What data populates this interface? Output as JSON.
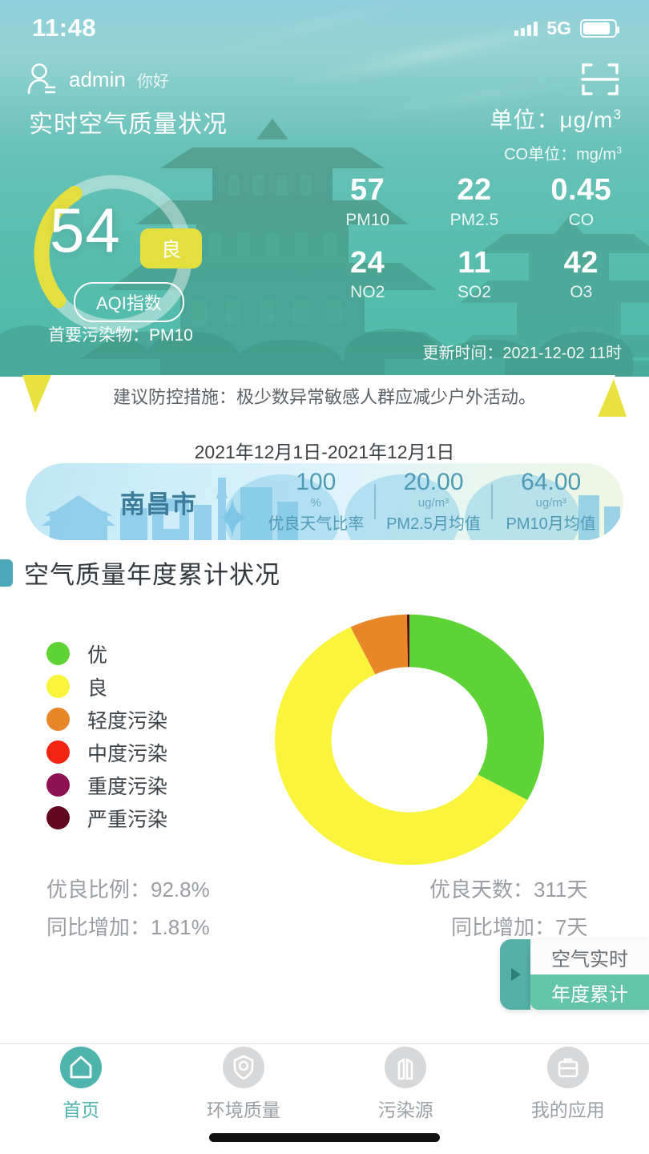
{
  "status_bar": {
    "time": "11:48",
    "network": "5G",
    "signal_icon": "signal-bars-icon",
    "battery_icon": "battery-icon"
  },
  "header": {
    "user_icon": "user-avatar-icon",
    "user_name": "admin",
    "greeting": "你好",
    "scan_icon": "scan-qr-icon",
    "title": "实时空气质量状况",
    "unit_label": "单位：",
    "unit_value": "μg/m",
    "unit_sup": "3",
    "co_unit_label": "CO单位：",
    "co_unit_value": "mg/m",
    "co_unit_sup": "3"
  },
  "aqi": {
    "value": "54",
    "level": "良",
    "chip": "AQI指数",
    "primary_label": "首要污染物：",
    "primary_value": "PM10",
    "updated_label": "更新时间：",
    "updated_value": "2021-12-02 11时",
    "gauge_color": "#e3df3f",
    "gauge_track_color": "rgba(255,255,255,0.45)",
    "gauge_percent": 27
  },
  "pollutants": [
    {
      "value": "57",
      "key": "PM10"
    },
    {
      "value": "22",
      "key": "PM2.5"
    },
    {
      "value": "0.45",
      "key": "CO"
    },
    {
      "value": "24",
      "key": "NO2"
    },
    {
      "value": "11",
      "key": "SO2"
    },
    {
      "value": "42",
      "key": "O3"
    }
  ],
  "advice": {
    "text": "建议防控措施：极少数异常敏感人群应减少户外活动。",
    "accent_color": "#e8e241"
  },
  "city_card": {
    "date_range": "2021年12月1日-2021年12月1日",
    "city": "南昌市",
    "stats": [
      {
        "value": "100",
        "unit": "%",
        "label": "优良天气比率"
      },
      {
        "value": "20.00",
        "unit": "ug/m³",
        "label": "PM2.5月均值"
      },
      {
        "value": "64.00",
        "unit": "ug/m³",
        "label": "PM10月均值"
      }
    ]
  },
  "section": {
    "title": "空气质量年度累计状况",
    "accent_color": "#4ca8b8"
  },
  "chart_data": {
    "type": "pie",
    "title": "空气质量年度累计状况",
    "legend_position": "left",
    "categories": [
      "优",
      "良",
      "轻度污染",
      "中度污染",
      "重度污染",
      "严重污染"
    ],
    "colors": [
      "#5ed336",
      "#fbf43c",
      "#e8862a",
      "#f42412",
      "#8e1055",
      "#61081e"
    ],
    "values": [
      33.0,
      59.8,
      6.9,
      0.0,
      0.0,
      0.3
    ],
    "unit": "%",
    "inner_radius_ratio": 0.58,
    "start_angle": 0
  },
  "summary": {
    "good_ratio_label": "优良比例：",
    "good_ratio_value": "92.8%",
    "yoy_ratio_label": "同比增加：",
    "yoy_ratio_value": "1.81%",
    "good_days_label": "优良天数：",
    "good_days_value": "311天",
    "yoy_days_label": "同比增加：",
    "yoy_days_value": "7天"
  },
  "float_tabs": {
    "handle_icon": "play-arrow-icon",
    "items": [
      {
        "label": "空气实时",
        "active": false
      },
      {
        "label": "年度累计",
        "active": true
      }
    ]
  },
  "bottom_nav": [
    {
      "label": "首页",
      "icon": "home-icon",
      "active": true
    },
    {
      "label": "环境质量",
      "icon": "quality-icon",
      "active": false
    },
    {
      "label": "污染源",
      "icon": "factory-icon",
      "active": false
    },
    {
      "label": "我的应用",
      "icon": "briefcase-icon",
      "active": false
    }
  ]
}
